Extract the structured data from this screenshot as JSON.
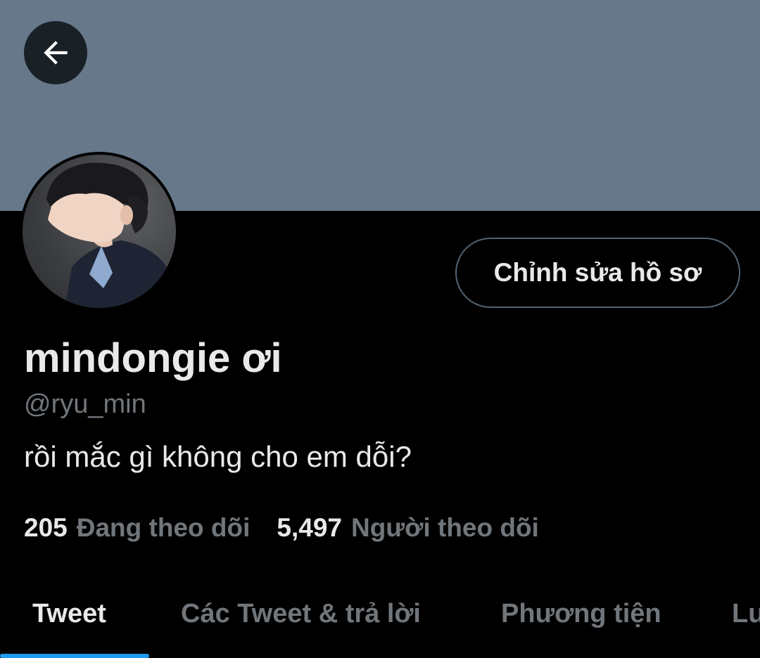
{
  "header": {
    "back_icon": "arrow-left-icon",
    "banner_color": "#66788a"
  },
  "profile": {
    "avatar_icon": "profile-photo",
    "edit_button_label": "Chỉnh sửa hồ sơ",
    "display_name": "mindongie ơi",
    "handle": "@ryu_min",
    "bio": "rồi mắc gì không cho em dỗi?"
  },
  "stats": {
    "following_count": "205",
    "following_label": "Đang theo dõi",
    "followers_count": "5,497",
    "followers_label": "Người theo dõi"
  },
  "tabs": [
    {
      "label": "Tweet",
      "active": true
    },
    {
      "label": "Các Tweet & trả lời",
      "active": false
    },
    {
      "label": "Phương tiện",
      "active": false
    },
    {
      "label": "Lượt thích",
      "active": false
    }
  ],
  "colors": {
    "background": "#000000",
    "primary_text": "#e7e9ea",
    "secondary_text": "#71767b",
    "accent": "#1d9bf0"
  }
}
